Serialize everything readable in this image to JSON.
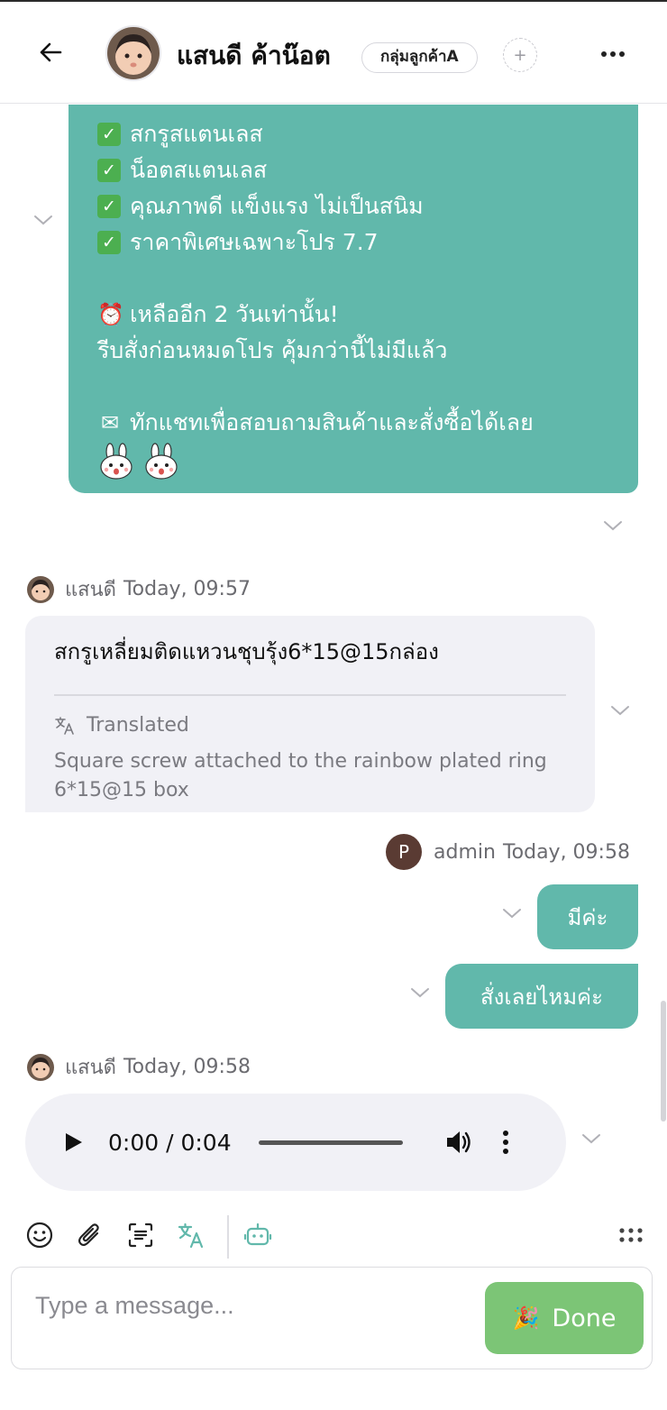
{
  "header": {
    "contact_name": "แสนดี ค้าน๊อต",
    "group_tag": "กลุ่มลูกค้าA",
    "add_tag_symbol": "+"
  },
  "promo_message": {
    "lines": [
      "สกรูสแตนเลส",
      "น็อตสแตนเลส",
      "คุณภาพดี แข็งแรง ไม่เป็นสนิม",
      "ราคาพิเศษเฉพาะโปร 7.7",
      "",
      "เหลืออีก 2 วันเท่านั้น!",
      "รีบสั่งก่อนหมดโปร คุ้มกว่านี้ไม่มีแล้ว",
      "",
      "ทักแชทเพื่อสอบถามสินค้าและสั่งซื้อได้เลย"
    ],
    "bubble_color": "#61b8ab"
  },
  "messages": {
    "customer_1": {
      "sender": "แสนดี",
      "time": "Today, 09:57",
      "text": "สกรูเหลี่ยมติดแหวนชุบรุ้ง6*15@15กล่อง",
      "translated_label": "Translated",
      "translation": "Square screw attached to the rainbow plated ring 6*15@15 box"
    },
    "admin_1": {
      "avatar_letter": "P",
      "sender": "admin",
      "time": "Today, 09:58",
      "replies": [
        "มีค่ะ",
        "สั่งเลยไหมค่ะ"
      ]
    },
    "customer_2": {
      "sender": "แสนดี",
      "time": "Today, 09:58",
      "audio_time": "0:00 / 0:04"
    }
  },
  "composer": {
    "placeholder": "Type a message...",
    "done_label": "Done",
    "done_color": "#7cc576"
  },
  "toolbar": {
    "icons": [
      "smile-icon",
      "paperclip-icon",
      "scan-text-icon",
      "translate-icon",
      "bot-icon",
      "more-grid-icon"
    ]
  }
}
